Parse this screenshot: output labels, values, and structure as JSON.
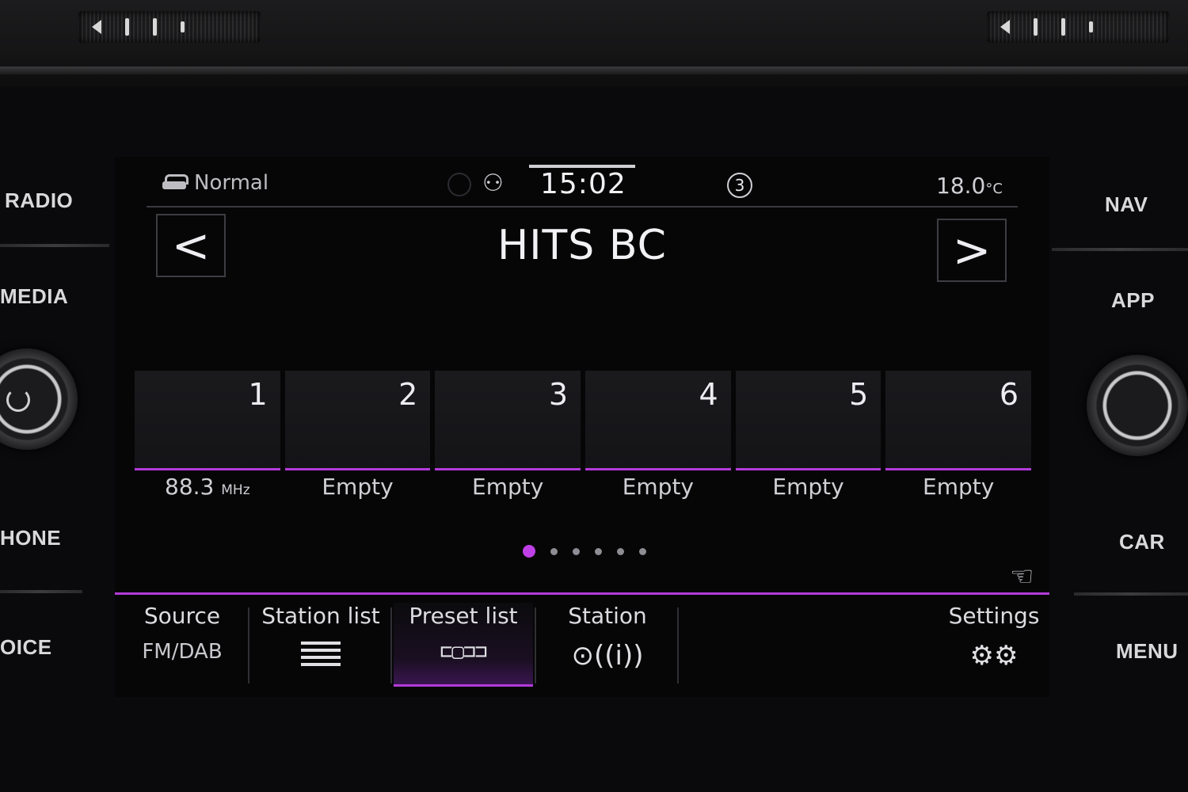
{
  "hardware": {
    "left_buttons": [
      "RADIO",
      "MEDIA",
      "HONE",
      "OICE"
    ],
    "right_buttons": [
      "NAV",
      "APP",
      "CAR",
      "MENU"
    ]
  },
  "status_bar": {
    "drive_mode": "Normal",
    "time": "15:02",
    "badge": "3",
    "temperature": "18.0",
    "temperature_unit": "°C"
  },
  "station": {
    "name": "HITS BC"
  },
  "presets": [
    {
      "number": "1",
      "value": "88.3",
      "unit": "MHz"
    },
    {
      "number": "2",
      "value": "Empty",
      "unit": ""
    },
    {
      "number": "3",
      "value": "Empty",
      "unit": ""
    },
    {
      "number": "4",
      "value": "Empty",
      "unit": ""
    },
    {
      "number": "5",
      "value": "Empty",
      "unit": ""
    },
    {
      "number": "6",
      "value": "Empty",
      "unit": ""
    }
  ],
  "pagination": {
    "total_pages": 6,
    "current_page": 1
  },
  "menu": {
    "source": {
      "label": "Source",
      "sub": "FM/DAB"
    },
    "station_list": {
      "label": "Station list",
      "icon": "list-icon"
    },
    "preset_list": {
      "label": "Preset list",
      "icon": "preset-grid-icon",
      "active": true
    },
    "station": {
      "label": "Station",
      "icon": "antenna-play-icon"
    },
    "settings": {
      "label": "Settings",
      "icon": "gear-icon"
    }
  },
  "colors": {
    "accent": "#b33bd9",
    "background": "#060607",
    "text": "#e8e8ec"
  }
}
